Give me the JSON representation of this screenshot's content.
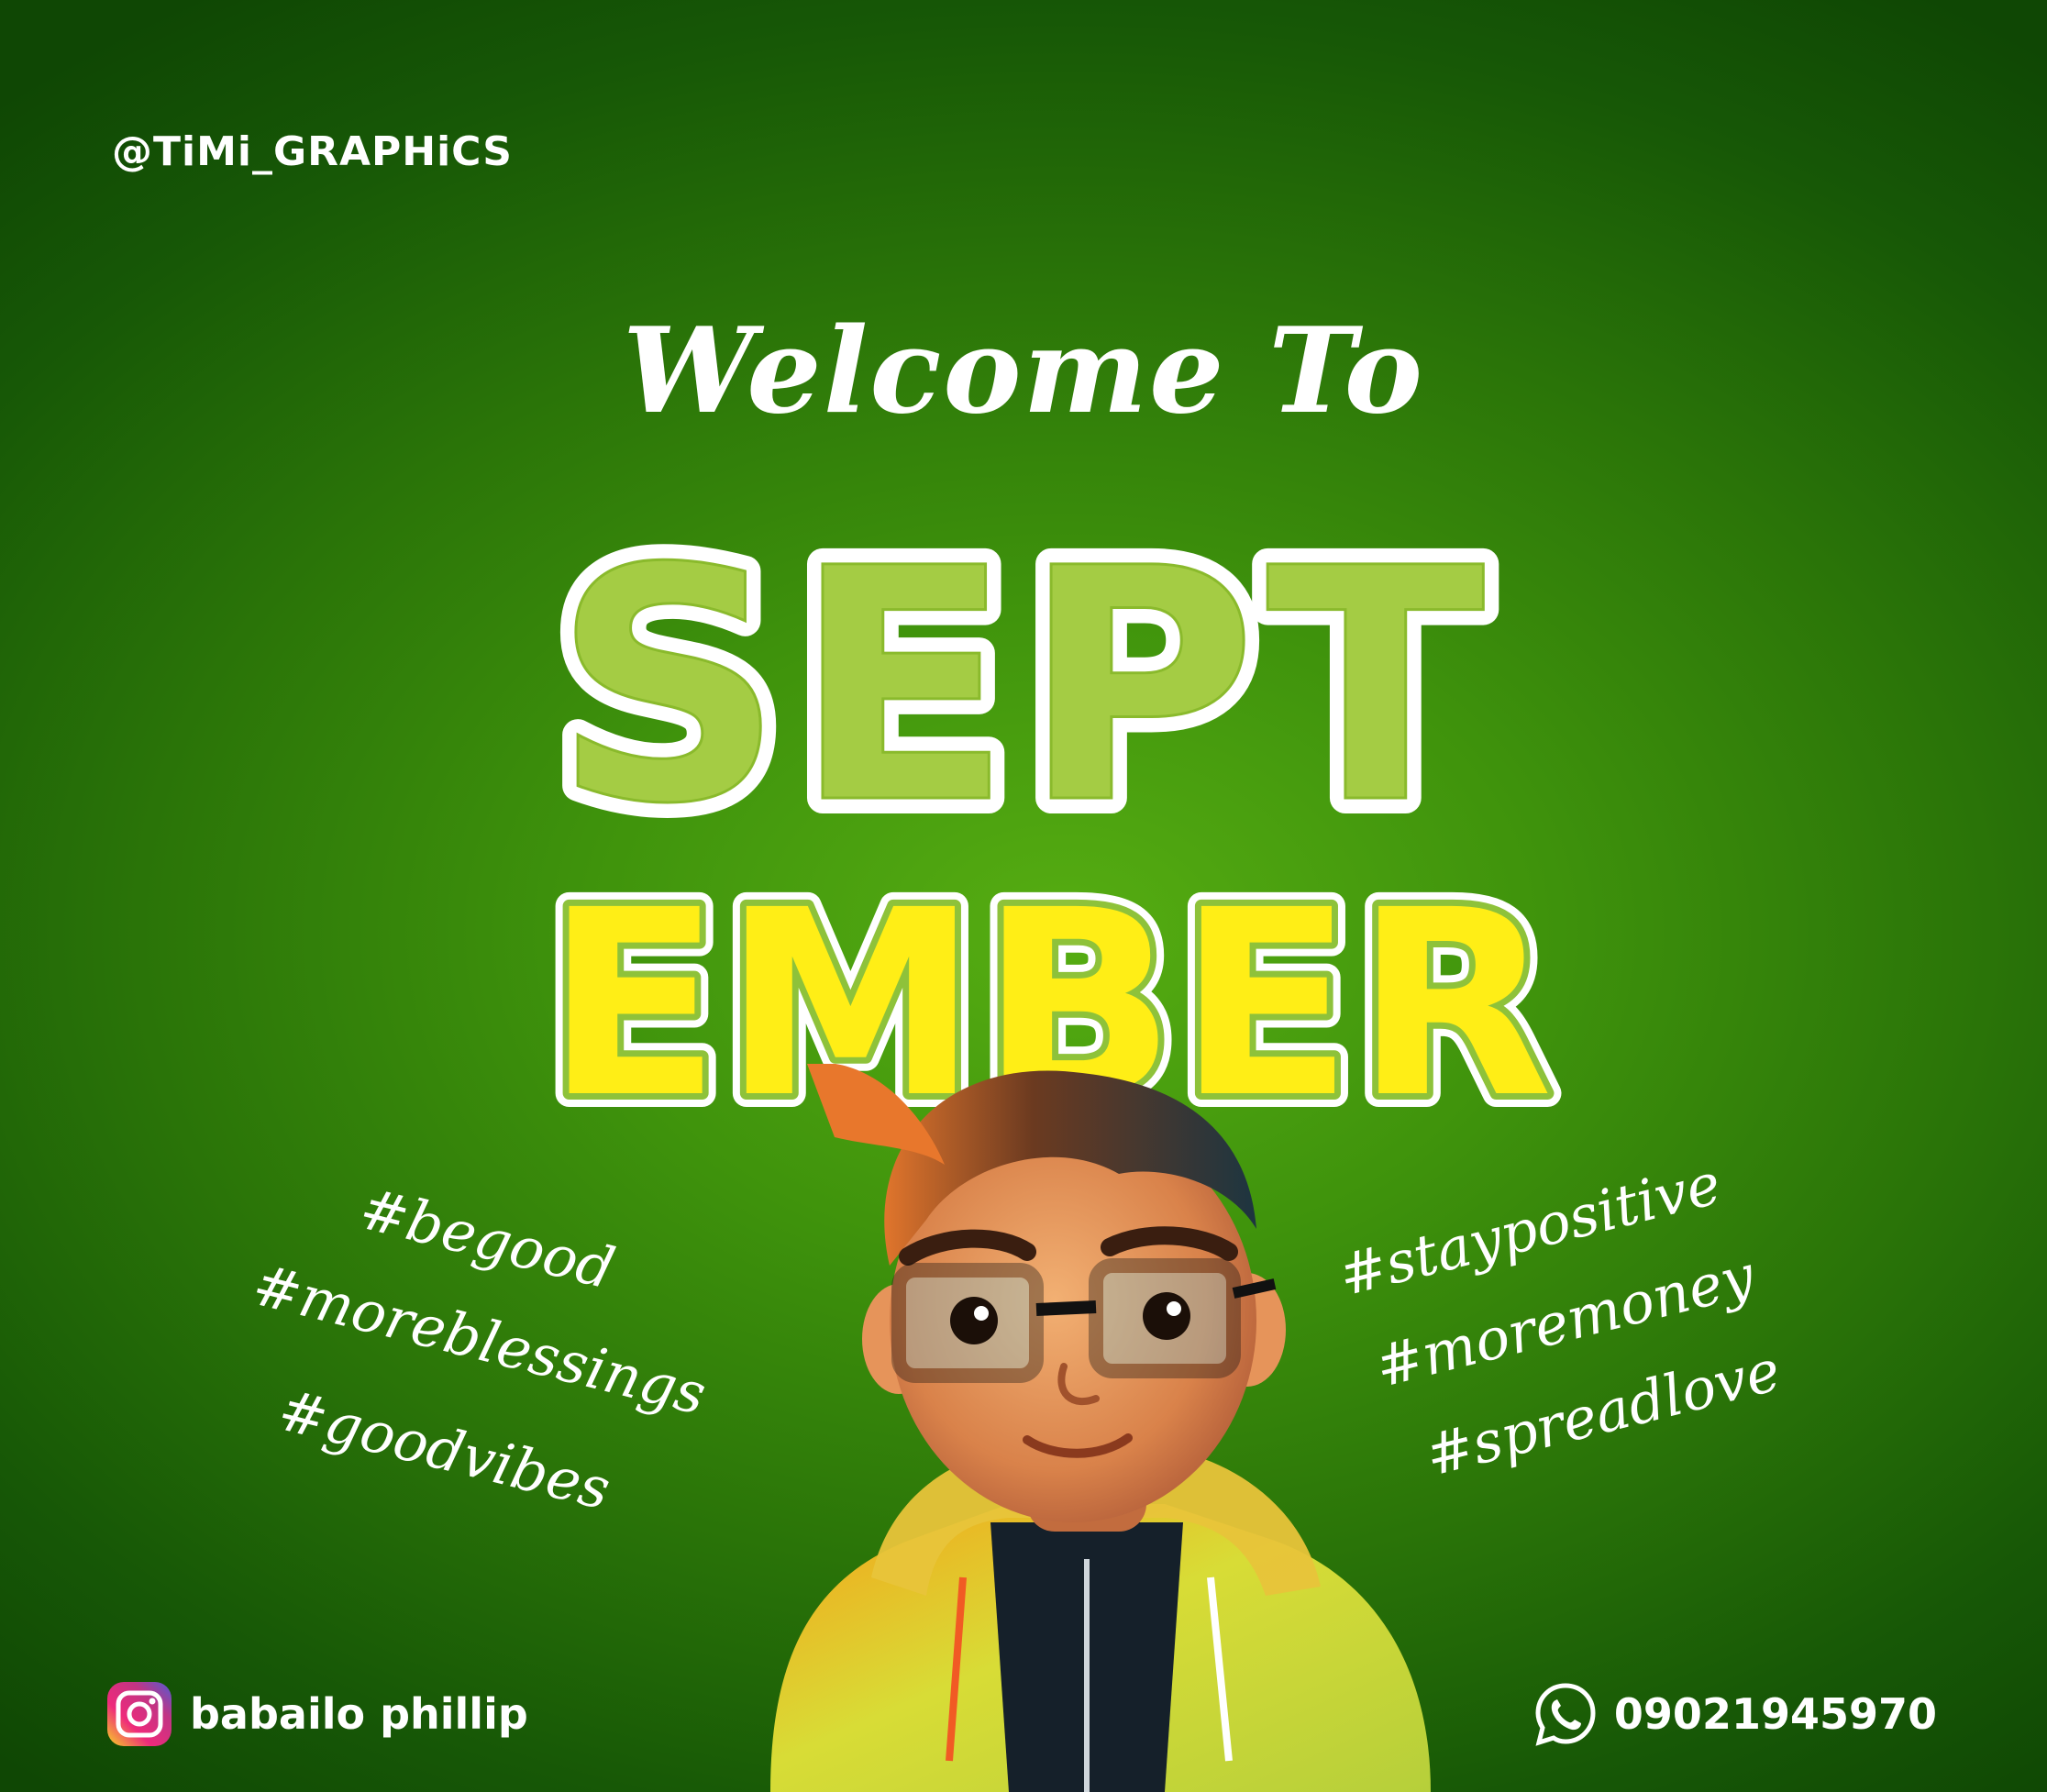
{
  "handle": "@TiMi_GRAPHiCS",
  "headline": {
    "welcome": "Welcome To",
    "line1": "SEPT",
    "line2": "EMBER"
  },
  "hashtags_left": [
    "#begood",
    "#moreblessings",
    "#goodvibes"
  ],
  "hashtags_right": [
    "#staypositive",
    "#moremoney",
    "#spreadlove"
  ],
  "footer": {
    "instagram_name": "babailo phillip",
    "whatsapp_number": "09021945970"
  },
  "icons": {
    "social": "instagram-icon",
    "phone": "whatsapp-icon"
  },
  "colors": {
    "background": "#3f930c",
    "sept_fill": "#a4cc44",
    "ember_fill": "#ffee16",
    "outline": "#ffffff",
    "text": "#ffffff"
  }
}
